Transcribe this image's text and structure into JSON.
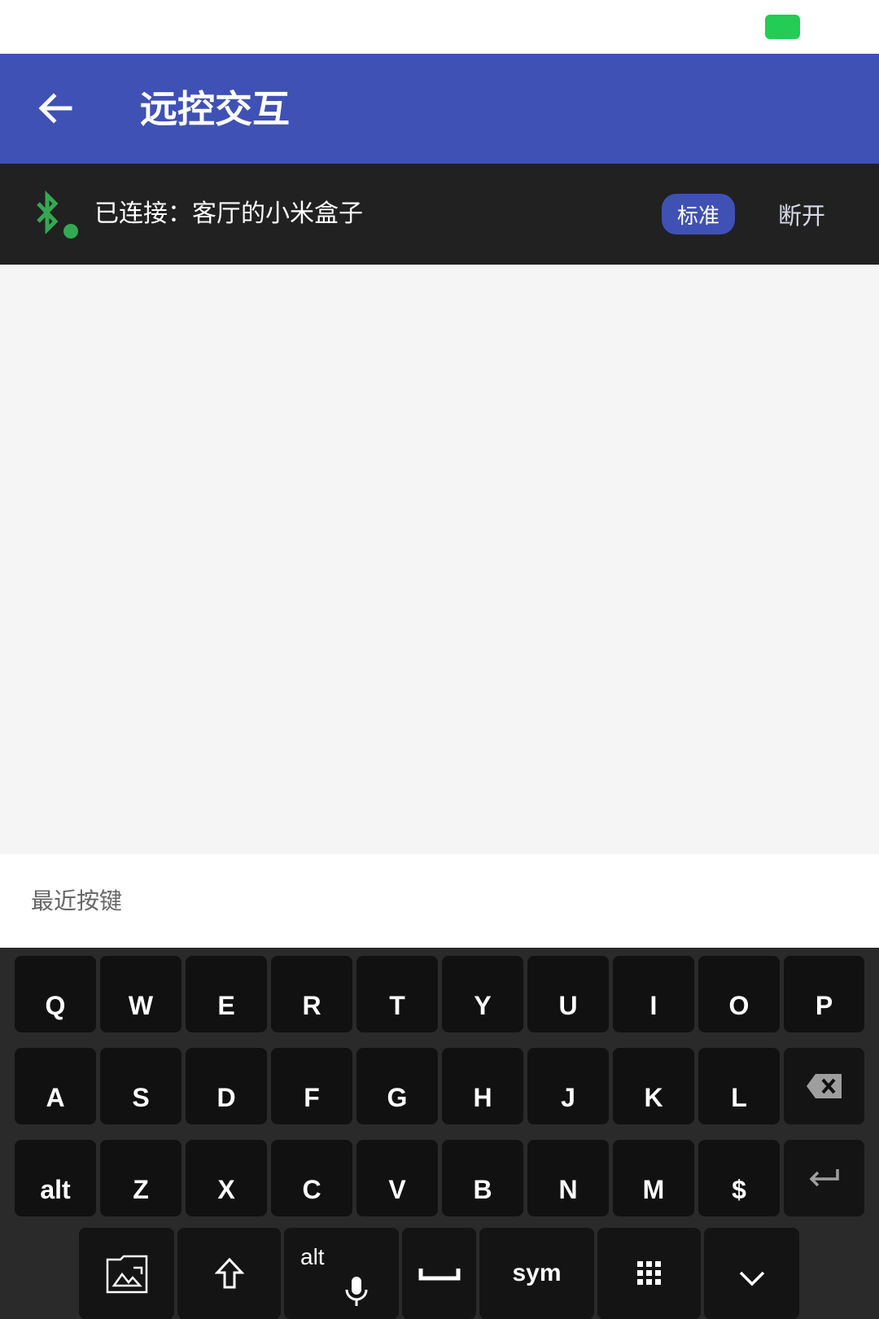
{
  "status_bar": {
    "battery_color": "#22cc55"
  },
  "app_bar": {
    "title": "远控交互",
    "back_icon": "arrow-back-icon",
    "color": "#3f51b5"
  },
  "connection": {
    "status_text": "已连接：客厅的小米盒子",
    "mode_label": "标准",
    "disconnect_label": "断开",
    "bluetooth_icon": "bluetooth-connected-icon",
    "indicator_color": "#34a853"
  },
  "recent": {
    "label": "最近按键"
  },
  "keyboard": {
    "row1": [
      "Q",
      "W",
      "E",
      "R",
      "T",
      "Y",
      "U",
      "I",
      "O",
      "P"
    ],
    "row2": [
      "A",
      "S",
      "D",
      "F",
      "G",
      "H",
      "J",
      "K",
      "L"
    ],
    "row3": [
      "alt",
      "Z",
      "X",
      "C",
      "V",
      "B",
      "N",
      "M",
      "$"
    ],
    "bottom": {
      "mic_alt_label": "alt",
      "sym_label": "sym"
    }
  }
}
